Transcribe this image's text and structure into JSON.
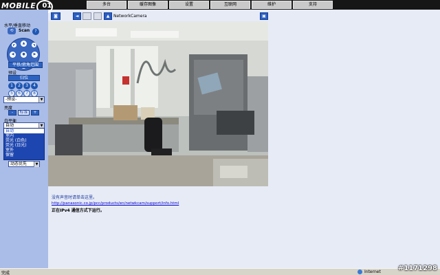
{
  "logo": {
    "text": "MOBILE",
    "mark": "01"
  },
  "top_tabs": [
    "多台",
    "缓存图像",
    "设置",
    "互联网",
    "维护",
    "支持"
  ],
  "sidebar": {
    "pantilt_title": "水平/垂直移动",
    "scan_label": "Scan",
    "scan_icon": "scan-icon",
    "help_label": "?",
    "full_range_btn": "平移/俯角范围",
    "preset_title": "预设",
    "home_btn": "归位",
    "preset_numbers": [
      "1",
      "2",
      "3",
      "4",
      "5",
      "6",
      "7",
      "8"
    ],
    "preset_select": "-预设-",
    "brightness_title": "亮度",
    "brightness_minus": "-",
    "brightness_std": "标准",
    "brightness_plus": "+",
    "wb_title": "白平衡",
    "wb_selected": "自动",
    "wb_options": [
      "自动",
      "室内",
      "荧光 (白色)",
      "荧光 (日光)",
      "室外",
      "保留"
    ],
    "speed_select": "动态优先"
  },
  "toolbar": {
    "camera_name": "NetworkCamera"
  },
  "info": {
    "no_audio_note": "没有声音时请单击这里。",
    "support_link": "http://panasonic.co.jp/pcc/products/en/netwkcam/support/info.html",
    "ipv6_note": "正在IPv4 通信方式下运行。"
  },
  "status": {
    "left_text": "完成",
    "zone_text": "Internet"
  },
  "watermark": "#1171298",
  "colors": {
    "top_bar": "#161616",
    "sidebar": "#aabde8",
    "accent": "#2d62c0",
    "page_bg": "#e7ebf6"
  }
}
